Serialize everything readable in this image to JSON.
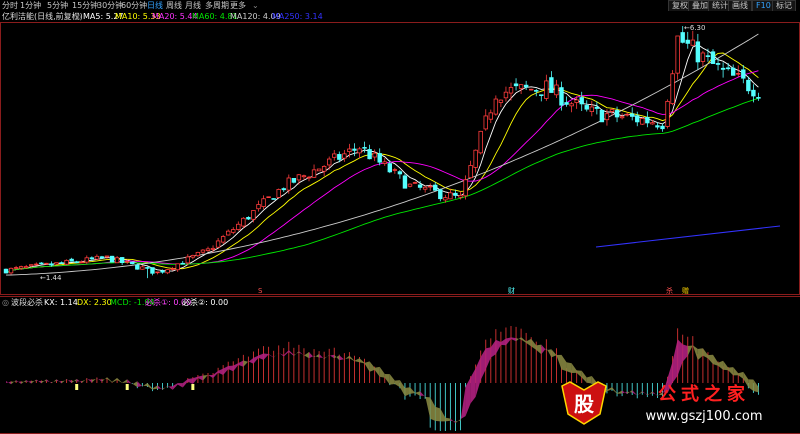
{
  "toolbar": {
    "tabs": [
      {
        "label": "分时",
        "active": false
      },
      {
        "label": "1分钟",
        "active": false
      },
      {
        "label": "5分钟",
        "active": false
      },
      {
        "label": "15分钟",
        "active": false
      },
      {
        "label": "30分钟",
        "active": false
      },
      {
        "label": "60分钟",
        "active": false
      },
      {
        "label": "日线",
        "active": true
      },
      {
        "label": "周线",
        "active": false
      },
      {
        "label": "月线",
        "active": false
      },
      {
        "label": "多周期",
        "active": false
      },
      {
        "label": "更多",
        "active": false
      }
    ],
    "right_buttons": [
      "复权",
      "叠加",
      "统计",
      "画线",
      "F10",
      "标记"
    ]
  },
  "info": {
    "name": "亿利洁能(日线,前复权)",
    "ma5": "MA5: 5.27",
    "ma10": "MA10: 5.33",
    "ma20": "MA20: 5.44",
    "ma60": "MA60: 4.81",
    "ma120": "MA120: 4.09",
    "ma250": "MA250: 3.14"
  },
  "indicator": {
    "name": "波段必杀",
    "kx": "KX: 1.14",
    "dx": "DX: 2.30",
    "mcd": "MCD: -1.94",
    "bs1": "必杀①: 0.00",
    "bs2": "必杀②: 0.00"
  },
  "price_labels": {
    "high": "6.30",
    "low": "1.44"
  },
  "event_marks": [
    "S",
    "财",
    "杀",
    "赠"
  ],
  "watermark": {
    "glyph": "股",
    "title": "公式之家",
    "url": "www.gszj100.com"
  },
  "colors": {
    "up": "#ff3c3c",
    "down": "#54ffff",
    "ma5": "#ffffff",
    "ma10": "#ffff00",
    "ma20": "#ff00ff",
    "ma60": "#00e600",
    "ma120": "#cccccc",
    "ma250": "#3333ff",
    "kx": "#ffffff",
    "dx": "#ffff00",
    "mcd": "#00e600",
    "bs1": "#ff44ff",
    "bs2": "#ffffff",
    "pink": "#b0207f",
    "olive": "#84843f"
  }
}
